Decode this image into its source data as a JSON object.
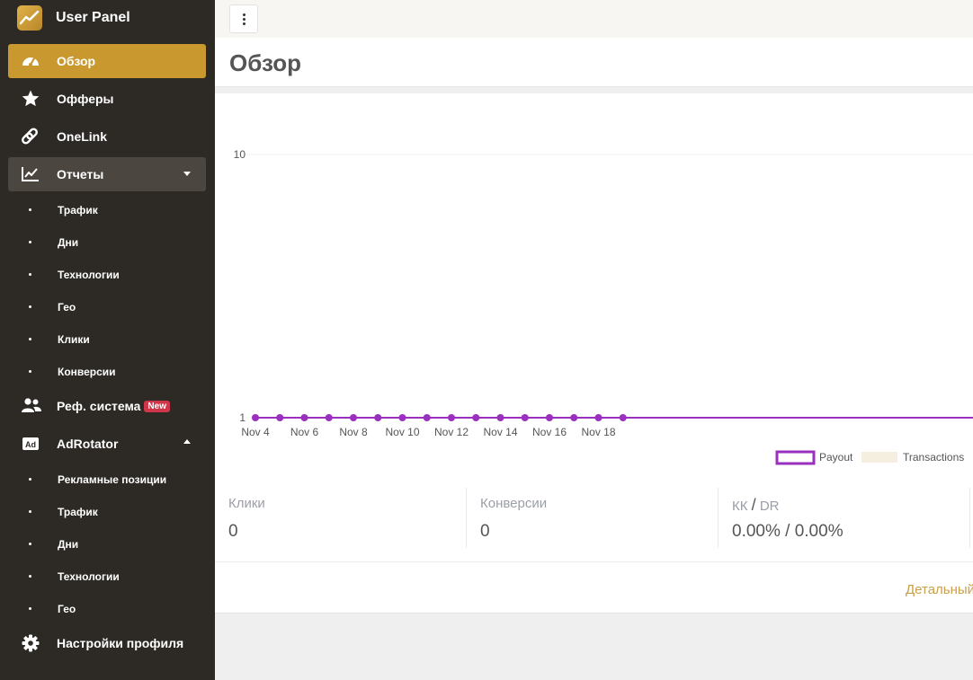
{
  "app": {
    "title": "User Panel"
  },
  "sidebar": {
    "items": [
      {
        "label": "Обзор",
        "icon": "dashboard-icon"
      },
      {
        "label": "Офферы",
        "icon": "star-icon"
      },
      {
        "label": "OneLink",
        "icon": "link-icon"
      },
      {
        "label": "Отчеты",
        "icon": "chart-icon"
      },
      {
        "label": "Реф. система",
        "icon": "users-icon",
        "badge": "New"
      },
      {
        "label": "AdRotator",
        "icon": "ad-icon"
      },
      {
        "label": "Настройки профиля",
        "icon": "gear-icon"
      }
    ],
    "reports_sub": [
      "Трафик",
      "Дни",
      "Технологии",
      "Гео",
      "Клики",
      "Конверсии"
    ],
    "adrotator_sub": [
      "Рекламные позиции",
      "Трафик",
      "Дни",
      "Технологии",
      "Гео"
    ]
  },
  "page": {
    "title": "Обзор"
  },
  "stats": {
    "clicks": {
      "label": "Клики",
      "value": "0"
    },
    "conversions": {
      "label": "Конверсии",
      "value": "0"
    },
    "kk_dr": {
      "label_kk": "КК",
      "sep": "/",
      "label_dr": "DR",
      "value": "0.00% / 0.00%"
    }
  },
  "details_link": "Детальный",
  "colors": {
    "accent": "#c9992f",
    "payout": "#9b2fbf",
    "transactions": "#f5efdf",
    "sidebar": "#2d2a25",
    "badge": "#d0354a"
  },
  "chart_data": {
    "type": "line",
    "x": [
      "Nov 4",
      "Nov 5",
      "Nov 6",
      "Nov 7",
      "Nov 8",
      "Nov 9",
      "Nov 10",
      "Nov 11",
      "Nov 12",
      "Nov 13",
      "Nov 14",
      "Nov 15",
      "Nov 16",
      "Nov 17",
      "Nov 18",
      "Nov 19"
    ],
    "x_tick_labels": [
      "Nov 4",
      "Nov 6",
      "Nov 8",
      "Nov 10",
      "Nov 12",
      "Nov 14",
      "Nov 16",
      "Nov 18"
    ],
    "y_tick_labels": [
      "1",
      "10"
    ],
    "yscale": "log",
    "ylim": [
      1,
      10
    ],
    "series": [
      {
        "name": "Payout",
        "color": "#9b2fbf",
        "values": [
          1,
          1,
          1,
          1,
          1,
          1,
          1,
          1,
          1,
          1,
          1,
          1,
          1,
          1,
          1,
          1
        ]
      },
      {
        "name": "Transactions",
        "color": "#f5efdf",
        "values": []
      }
    ],
    "legend": "bottom-right",
    "grid": true
  }
}
